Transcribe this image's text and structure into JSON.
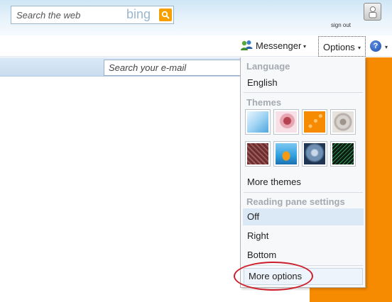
{
  "header": {
    "search_placeholder": "Search the web",
    "search_engine_logo": "bing",
    "search_go_icon": "magnifier-icon",
    "sign_out": "sign out",
    "avatar_icon": "user-avatar-icon"
  },
  "toolbar": {
    "messenger_label": "Messenger",
    "messenger_icon": "messenger-people-icon",
    "options_label": "Options",
    "help_label": "?",
    "caret": "▾"
  },
  "email_search": {
    "placeholder": "Search your e-mail"
  },
  "options_menu": {
    "language": {
      "heading": "Language",
      "current": "English"
    },
    "themes": {
      "heading": "Themes",
      "swatches": [
        {
          "name": "sky",
          "colors": [
            "#5fb3e6",
            "#e9f5fd"
          ]
        },
        {
          "name": "blossom",
          "colors": [
            "#f7e1e6",
            "#b5424f"
          ]
        },
        {
          "name": "orange-dots",
          "colors": [
            "#f68a00",
            "#ffc46b"
          ]
        },
        {
          "name": "lace",
          "colors": [
            "#d8d3cf",
            "#9e948c"
          ]
        },
        {
          "name": "weave",
          "colors": [
            "#6b2f2f",
            "#c08080"
          ]
        },
        {
          "name": "cartoon",
          "colors": [
            "#2e9fe0",
            "#f59a17"
          ]
        },
        {
          "name": "storm",
          "colors": [
            "#1f3551",
            "#9ab4d0"
          ]
        },
        {
          "name": "green-mesh",
          "colors": [
            "#0e1a14",
            "#2f9a52"
          ]
        }
      ],
      "more_label": "More themes"
    },
    "reading_pane": {
      "heading": "Reading pane settings",
      "options": [
        "Off",
        "Right",
        "Bottom"
      ],
      "selected": "Off"
    },
    "more_options_label": "More options"
  },
  "colors": {
    "accent_orange": "#f68a00",
    "highlight_circle": "#cc1f2b",
    "selected_row": "#dbe8f6"
  }
}
